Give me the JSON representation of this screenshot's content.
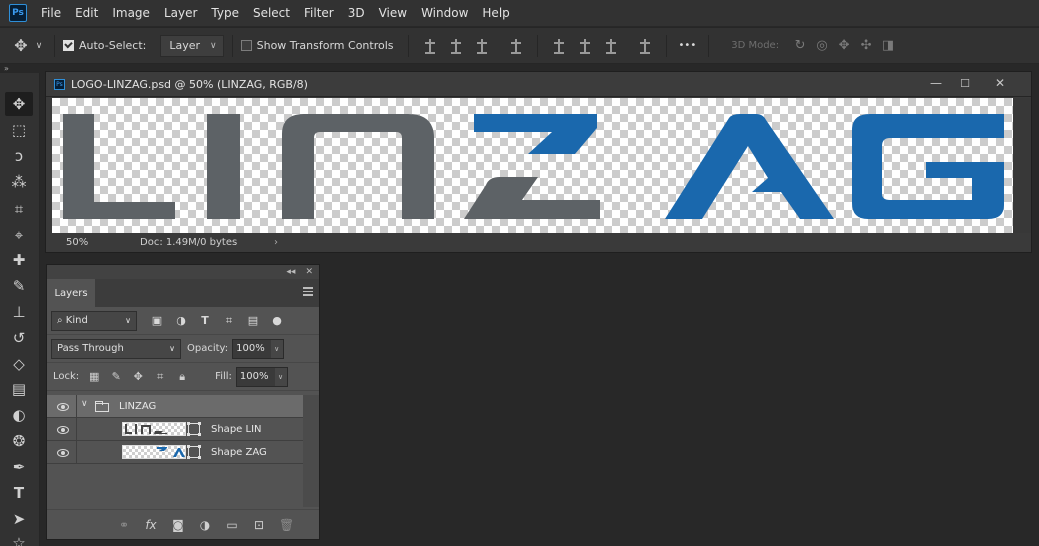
{
  "app": {
    "logo_text": "Ps"
  },
  "menubar": {
    "items": [
      "File",
      "Edit",
      "Image",
      "Layer",
      "Type",
      "Select",
      "Filter",
      "3D",
      "View",
      "Window",
      "Help"
    ]
  },
  "options_bar": {
    "auto_select_label": "Auto-Select:",
    "auto_select_checked": true,
    "auto_select_target": "Layer",
    "show_transform_label": "Show Transform Controls",
    "show_transform_checked": false,
    "more_label": "•••",
    "mode_3d_label": "3D Mode:"
  },
  "toolbar": {
    "collapse_label": "»",
    "tools": [
      {
        "name": "move-tool",
        "glyph": "✥"
      },
      {
        "name": "marquee-tool",
        "glyph": "⬚"
      },
      {
        "name": "lasso-tool",
        "glyph": "ↄ"
      },
      {
        "name": "magic-wand-tool",
        "glyph": "⁂"
      },
      {
        "name": "crop-tool",
        "glyph": "⌗"
      },
      {
        "name": "eyedropper-tool",
        "glyph": "⌖"
      },
      {
        "name": "healing-tool",
        "glyph": "✚"
      },
      {
        "name": "brush-tool",
        "glyph": "✎"
      },
      {
        "name": "stamp-tool",
        "glyph": "⊥"
      },
      {
        "name": "history-brush-tool",
        "glyph": "↺"
      },
      {
        "name": "eraser-tool",
        "glyph": "◇"
      },
      {
        "name": "gradient-tool",
        "glyph": "▤"
      },
      {
        "name": "blur-tool",
        "glyph": "◐"
      },
      {
        "name": "dodge-tool",
        "glyph": "❂"
      },
      {
        "name": "pen-tool",
        "glyph": "✒"
      },
      {
        "name": "type-tool",
        "glyph": "T"
      },
      {
        "name": "path-selection-tool",
        "glyph": "➤"
      },
      {
        "name": "shape-tool",
        "glyph": "☆"
      }
    ]
  },
  "document": {
    "title": "LOGO-LINZAG.psd @ 50% (LINZAG, RGB/8)",
    "minimize_glyph": "—",
    "maximize_glyph": "☐",
    "close_glyph": "✕",
    "zoom": "50%",
    "doc_info": "Doc: 1.49M/0 bytes",
    "status_arrow": "›",
    "colors": {
      "gray_letters": "#5d6266",
      "blue_letters": "#1a68ad"
    }
  },
  "layers_panel": {
    "collapse_glyph": "◂◂",
    "close_glyph": "✕",
    "tab_label": "Layers",
    "filter_kind": "Kind",
    "blend_mode": "Pass Through",
    "opacity_label": "Opacity:",
    "opacity_value": "100%",
    "lock_label": "Lock:",
    "fill_label": "Fill:",
    "fill_value": "100%",
    "layers": [
      {
        "name": "LINZAG",
        "type": "group",
        "visible": true,
        "selected": true
      },
      {
        "name": "Shape LIN",
        "type": "shape",
        "visible": true
      },
      {
        "name": "Shape ZAG",
        "type": "shape",
        "visible": true
      }
    ]
  }
}
